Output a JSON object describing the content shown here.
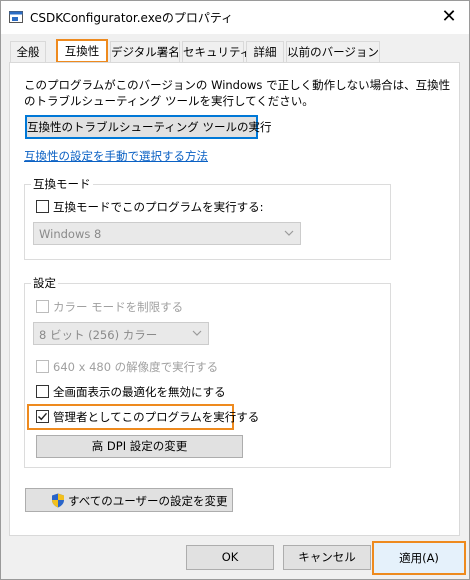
{
  "window": {
    "title": "CSDKConfigurator.exeのプロパティ",
    "close_glyph": "✕"
  },
  "tabs": [
    {
      "label": "全般"
    },
    {
      "label": "互換性"
    },
    {
      "label": "デジタル署名"
    },
    {
      "label": "セキュリティ"
    },
    {
      "label": "詳細"
    },
    {
      "label": "以前のバージョン"
    }
  ],
  "intro": {
    "line1": "このプログラムがこのバージョンの Windows で正しく動作しない場合は、互換性",
    "line2": "のトラブルシューティング ツールを実行してください。"
  },
  "troubleshoot_button": "互換性のトラブルシューティング ツールの実行",
  "manual_link": "互換性の設定を手動で選択する方法",
  "compat_mode": {
    "group_title": "互換モード",
    "checkbox_label": "互換モードでこのプログラムを実行する:",
    "checked": false,
    "os_select_value": "Windows 8"
  },
  "settings": {
    "group_title": "設定",
    "reduced_color_label": "カラー モードを制限する",
    "color_select_value": "8 ビット (256) カラー",
    "resolution_label": "640 x 480 の解像度で実行する",
    "fullscreen_opt_label": "全画面表示の最適化を無効にする",
    "run_as_admin_label": "管理者としてこのプログラムを実行する",
    "run_as_admin_checked": true,
    "dpi_button": "高 DPI 設定の変更"
  },
  "all_users_button": "すべてのユーザーの設定を変更",
  "footer": {
    "ok": "OK",
    "cancel": "キャンセル",
    "apply": "適用(A)"
  },
  "colors": {
    "highlight": "#ee8a1e",
    "link": "#0b61c4",
    "focus": "#0078d7"
  }
}
